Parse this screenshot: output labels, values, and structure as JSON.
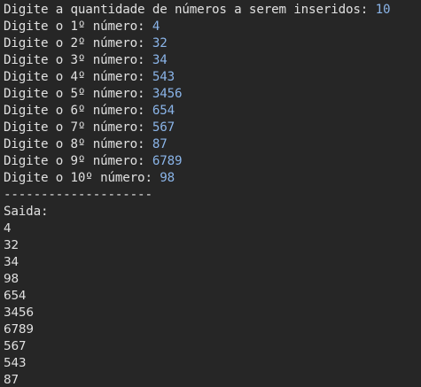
{
  "colors": {
    "background": "#262626",
    "text": "#e0e0e0",
    "input": "#8ab4e8"
  },
  "prompts": [
    {
      "text": "Digite a quantidade de números a serem inseridos: ",
      "value": "10"
    },
    {
      "text": "Digite o 1º número: ",
      "value": "4"
    },
    {
      "text": "Digite o 2º número: ",
      "value": "32"
    },
    {
      "text": "Digite o 3º número: ",
      "value": "34"
    },
    {
      "text": "Digite o 4º número: ",
      "value": "543"
    },
    {
      "text": "Digite o 5º número: ",
      "value": "3456"
    },
    {
      "text": "Digite o 6º número: ",
      "value": "654"
    },
    {
      "text": "Digite o 7º número: ",
      "value": "567"
    },
    {
      "text": "Digite o 8º número: ",
      "value": "87"
    },
    {
      "text": "Digite o 9º número: ",
      "value": "6789"
    },
    {
      "text": "Digite o 10º número: ",
      "value": "98"
    }
  ],
  "separator": "--------------------",
  "output_label": "Saida:",
  "output": [
    "4",
    "32",
    "34",
    "98",
    "654",
    "3456",
    "6789",
    "567",
    "543",
    "87"
  ]
}
